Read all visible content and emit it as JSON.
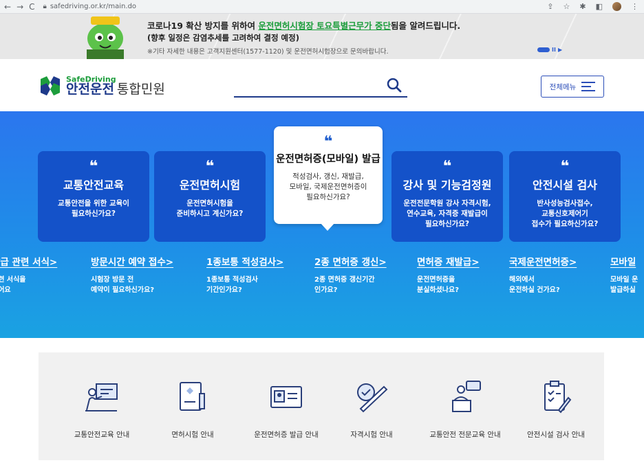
{
  "browser": {
    "url": "safedriving.or.kr/main.do"
  },
  "notice": {
    "line1_pre": "코로나19 확산 방지를 위하여 ",
    "line1_em": "운전면허시험장 토요특별근무가 중단",
    "line1_post": "됨을 알려드립니다.",
    "line2": "(향후 일정은 감염추세를 고려하여 결정 예정)",
    "line3": "※기타 자세한 내용은 고객지원센터(1577-1120) 및 운전면허시험장으로 문의바랍니다."
  },
  "header": {
    "logo_en": "SafeDriving",
    "logo_ko1": "안전운전",
    "logo_ko2": "통합민원",
    "search_placeholder": "",
    "menu_label": "전체메뉴"
  },
  "cards": [
    {
      "title": "교통안전교육",
      "desc1": "교통안전을 위한 교육이",
      "desc2": "필요하신가요?",
      "desc3": ""
    },
    {
      "title": "운전면허시험",
      "desc1": "운전면허시험을",
      "desc2": "준비하시고 계신가요?",
      "desc3": ""
    },
    {
      "title": "운전면허증(모바일) 발급",
      "desc1": "적성검사, 갱신, 재발급,",
      "desc2": "모바일, 국제운전면허증이",
      "desc3": "필요하신가요?"
    },
    {
      "title": "강사 및 기능검정원",
      "desc1": "운전전문학원 강사 자격시험,",
      "desc2": "연수교육, 자격증 재발급이",
      "desc3": "필요하신가요?"
    },
    {
      "title": "안전시설 검사",
      "desc1": "반사성능검사접수,",
      "desc2": "교통신호제어기",
      "desc3": "접수가 필요하신가요?"
    }
  ],
  "subs": [
    {
      "title": "발급 관련 서식>",
      "d1": "관련 서식을",
      "d2": "있어요"
    },
    {
      "title": "방문시간 예약 접수>",
      "d1": "시험장 방문 전",
      "d2": "예약이 필요하신가요?"
    },
    {
      "title": "1종보통 적성검사>",
      "d1": "1종보통 적성검사",
      "d2": "기간인가요?"
    },
    {
      "title": "2종 면허증 갱신>",
      "d1": "2종 면허증 갱신기간",
      "d2": "인가요?"
    },
    {
      "title": "면허증 재발급>",
      "d1": "운전면허증을",
      "d2": "분실하셨나요?"
    },
    {
      "title": "국제운전면허증>",
      "d1": "해외에서",
      "d2": "운전하실 건가요?"
    },
    {
      "title": "모바일 ",
      "d1": "모바일 운",
      "d2": "발급하실"
    }
  ],
  "quick": [
    {
      "label": "교통안전교육 안내",
      "icon": "lecture-icon"
    },
    {
      "label": "면허시험 안내",
      "icon": "exam-document-icon"
    },
    {
      "label": "운전면허증 발급 안내",
      "icon": "license-card-icon"
    },
    {
      "label": "자격시험 안내",
      "icon": "certification-pen-icon"
    },
    {
      "label": "교통안전 전문교육 안내",
      "icon": "speaker-podium-icon"
    },
    {
      "label": "안전시설 검사 안내",
      "icon": "checklist-icon"
    }
  ]
}
